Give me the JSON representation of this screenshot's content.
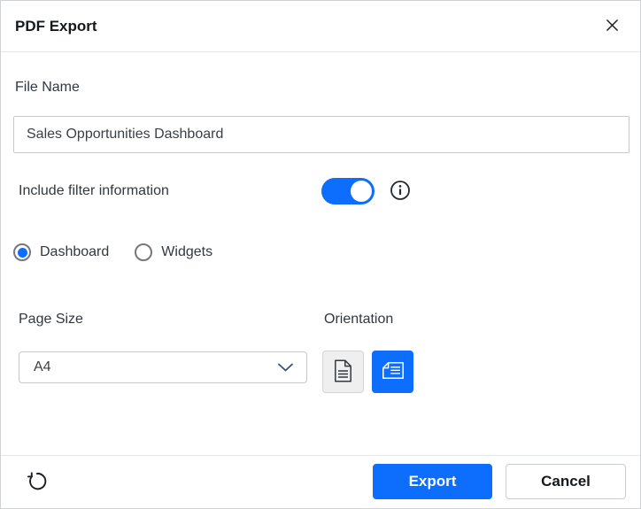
{
  "dialog": {
    "title": "PDF Export"
  },
  "file_name": {
    "label": "File Name",
    "value": "Sales Opportunities Dashboard"
  },
  "filter_toggle": {
    "label": "Include filter information",
    "enabled": true
  },
  "export_target": {
    "options": [
      {
        "label": "Dashboard",
        "selected": true
      },
      {
        "label": "Widgets",
        "selected": false
      }
    ]
  },
  "page_size": {
    "label": "Page Size",
    "value": "A4"
  },
  "orientation": {
    "label": "Orientation",
    "options": [
      "portrait",
      "landscape"
    ],
    "selected": "landscape"
  },
  "footer": {
    "export_label": "Export",
    "cancel_label": "Cancel"
  },
  "icons": {
    "close": "close-icon",
    "info": "info-icon",
    "chevron": "chevron-down-icon",
    "portrait": "portrait-page-icon",
    "landscape": "landscape-page-icon",
    "reset": "reset-icon"
  },
  "colors": {
    "accent": "#0d6efd",
    "border": "#c5c9cc",
    "divider": "#e4e6e8",
    "text": "#32383e"
  }
}
